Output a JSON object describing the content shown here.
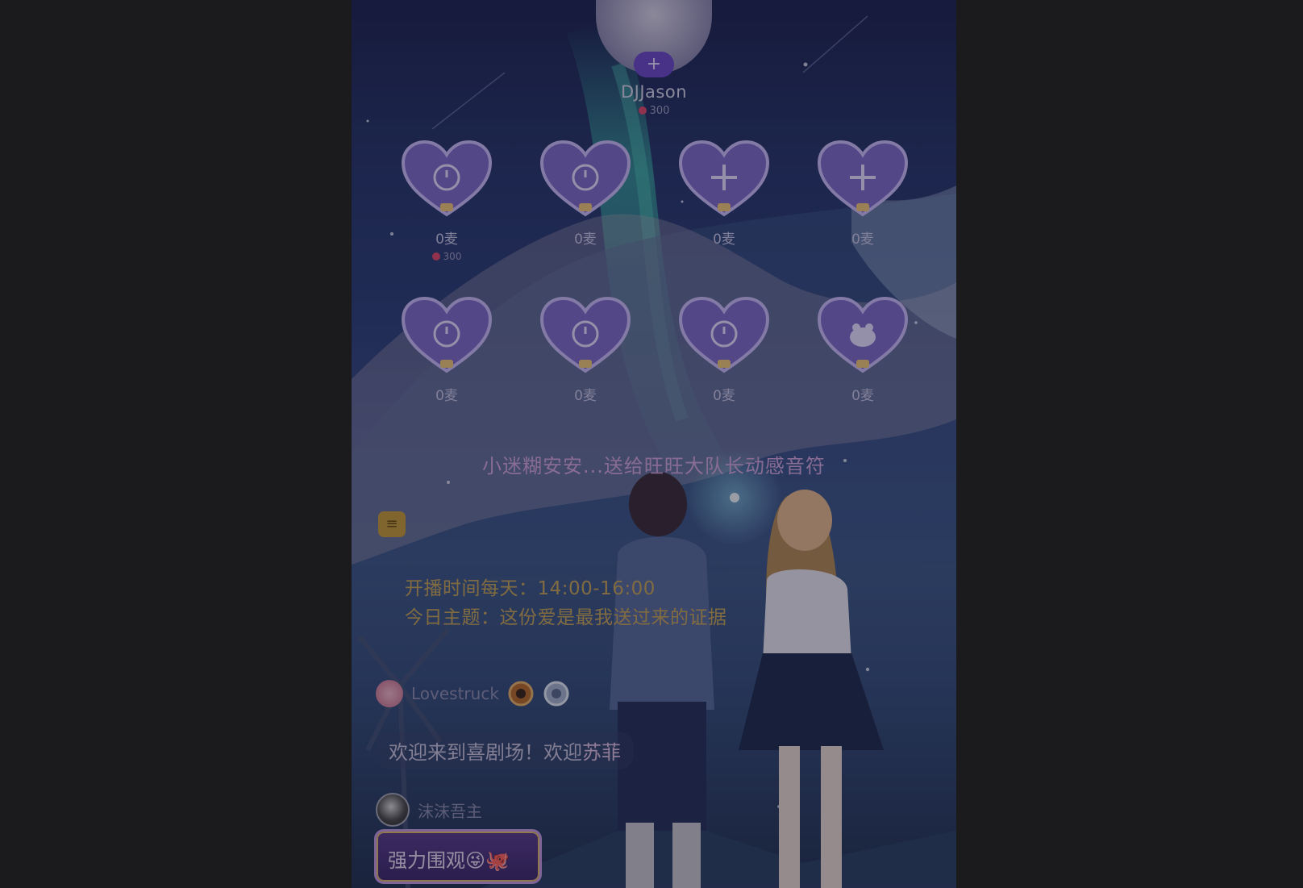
{
  "host": {
    "name": "DJJason",
    "score": "300",
    "add_label": "+"
  },
  "seats": [
    {
      "label": "0麦",
      "score": "300",
      "icon": "clock-icon"
    },
    {
      "label": "0麦",
      "score": "",
      "icon": "clock-icon"
    },
    {
      "label": "0麦",
      "score": "",
      "icon": "plus-icon"
    },
    {
      "label": "0麦",
      "score": "",
      "icon": "plus-icon"
    },
    {
      "label": "0麦",
      "score": "",
      "icon": "clock-icon"
    },
    {
      "label": "0麦",
      "score": "",
      "icon": "clock-icon"
    },
    {
      "label": "0麦",
      "score": "",
      "icon": "clock-icon"
    },
    {
      "label": "0麦",
      "score": "",
      "icon": "frog-icon"
    }
  ],
  "marquee": "小迷糊安安...送给旺旺大队长动感音符",
  "announcement": {
    "line1": "开播时间每天：14:00-16:00",
    "line2": "今日主题：这份爱是最我送过来的证据"
  },
  "chat": {
    "user1_name": "Lovestruck",
    "welcome_prefix": "欢迎来到喜剧场！欢迎",
    "welcome_name": "苏菲",
    "user2_name": "沫沫吾主",
    "message": "强力围观😜🐙"
  },
  "colors": {
    "accent_purple": "#6b49c8",
    "marquee_pink": "#d3a7de",
    "announce_gold": "#c8a557"
  }
}
